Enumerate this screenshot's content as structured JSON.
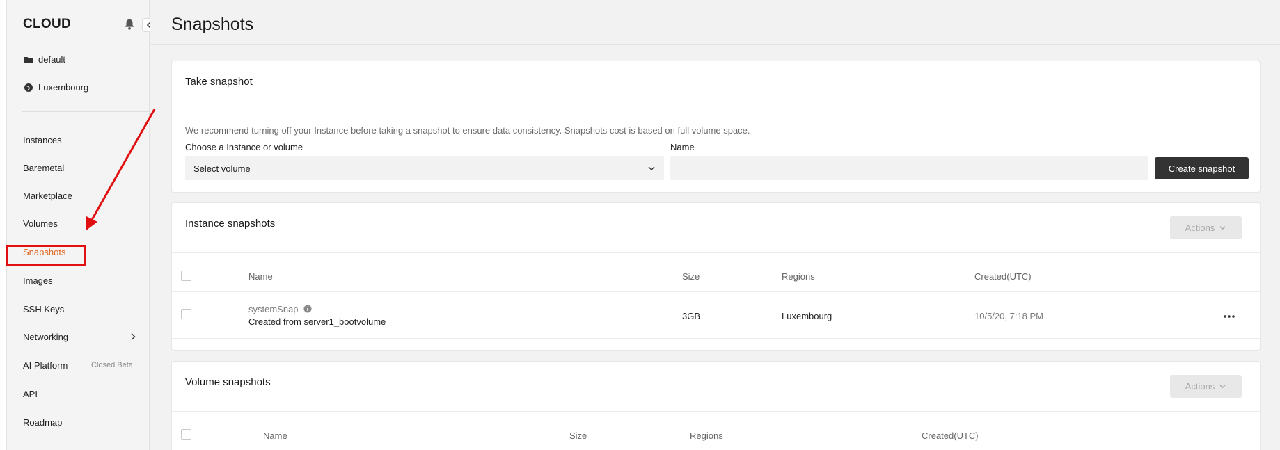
{
  "sidebar": {
    "brand": "CLOUD",
    "project": "default",
    "region": "Luxembourg",
    "nav": [
      {
        "label": "Instances"
      },
      {
        "label": "Baremetal"
      },
      {
        "label": "Marketplace"
      },
      {
        "label": "Volumes"
      },
      {
        "label": "Snapshots",
        "active": true
      },
      {
        "label": "Images"
      },
      {
        "label": "SSH Keys"
      },
      {
        "label": "Networking"
      },
      {
        "label": "AI Platform",
        "badge": "Closed Beta"
      },
      {
        "label": "API"
      },
      {
        "label": "Roadmap"
      }
    ]
  },
  "page": {
    "title": "Snapshots"
  },
  "take_snapshot": {
    "title": "Take snapshot",
    "hint": "We recommend turning off your Instance before taking a snapshot to ensure data consistency. Snapshots cost is based on full volume space.",
    "choose_label": "Choose a Instance or volume",
    "select_value": "Select volume",
    "name_label": "Name",
    "name_value": "",
    "create_button": "Create snapshot"
  },
  "instance_snapshots": {
    "title": "Instance snapshots",
    "actions": "Actions",
    "columns": [
      "Name",
      "Size",
      "Regions",
      "Created(UTC)"
    ],
    "rows": [
      {
        "name": "systemSnap",
        "description": "Created from server1_bootvolume",
        "size": "3GB",
        "region": "Luxembourg",
        "created": "10/5/20, 7:18 PM"
      }
    ]
  },
  "volume_snapshots": {
    "title": "Volume snapshots",
    "actions": "Actions",
    "columns": [
      "Name",
      "Size",
      "Regions",
      "Created(UTC)"
    ]
  },
  "colors": {
    "accent": "#e0641e",
    "annotation": "#e01010",
    "primary_button": "#333333"
  }
}
